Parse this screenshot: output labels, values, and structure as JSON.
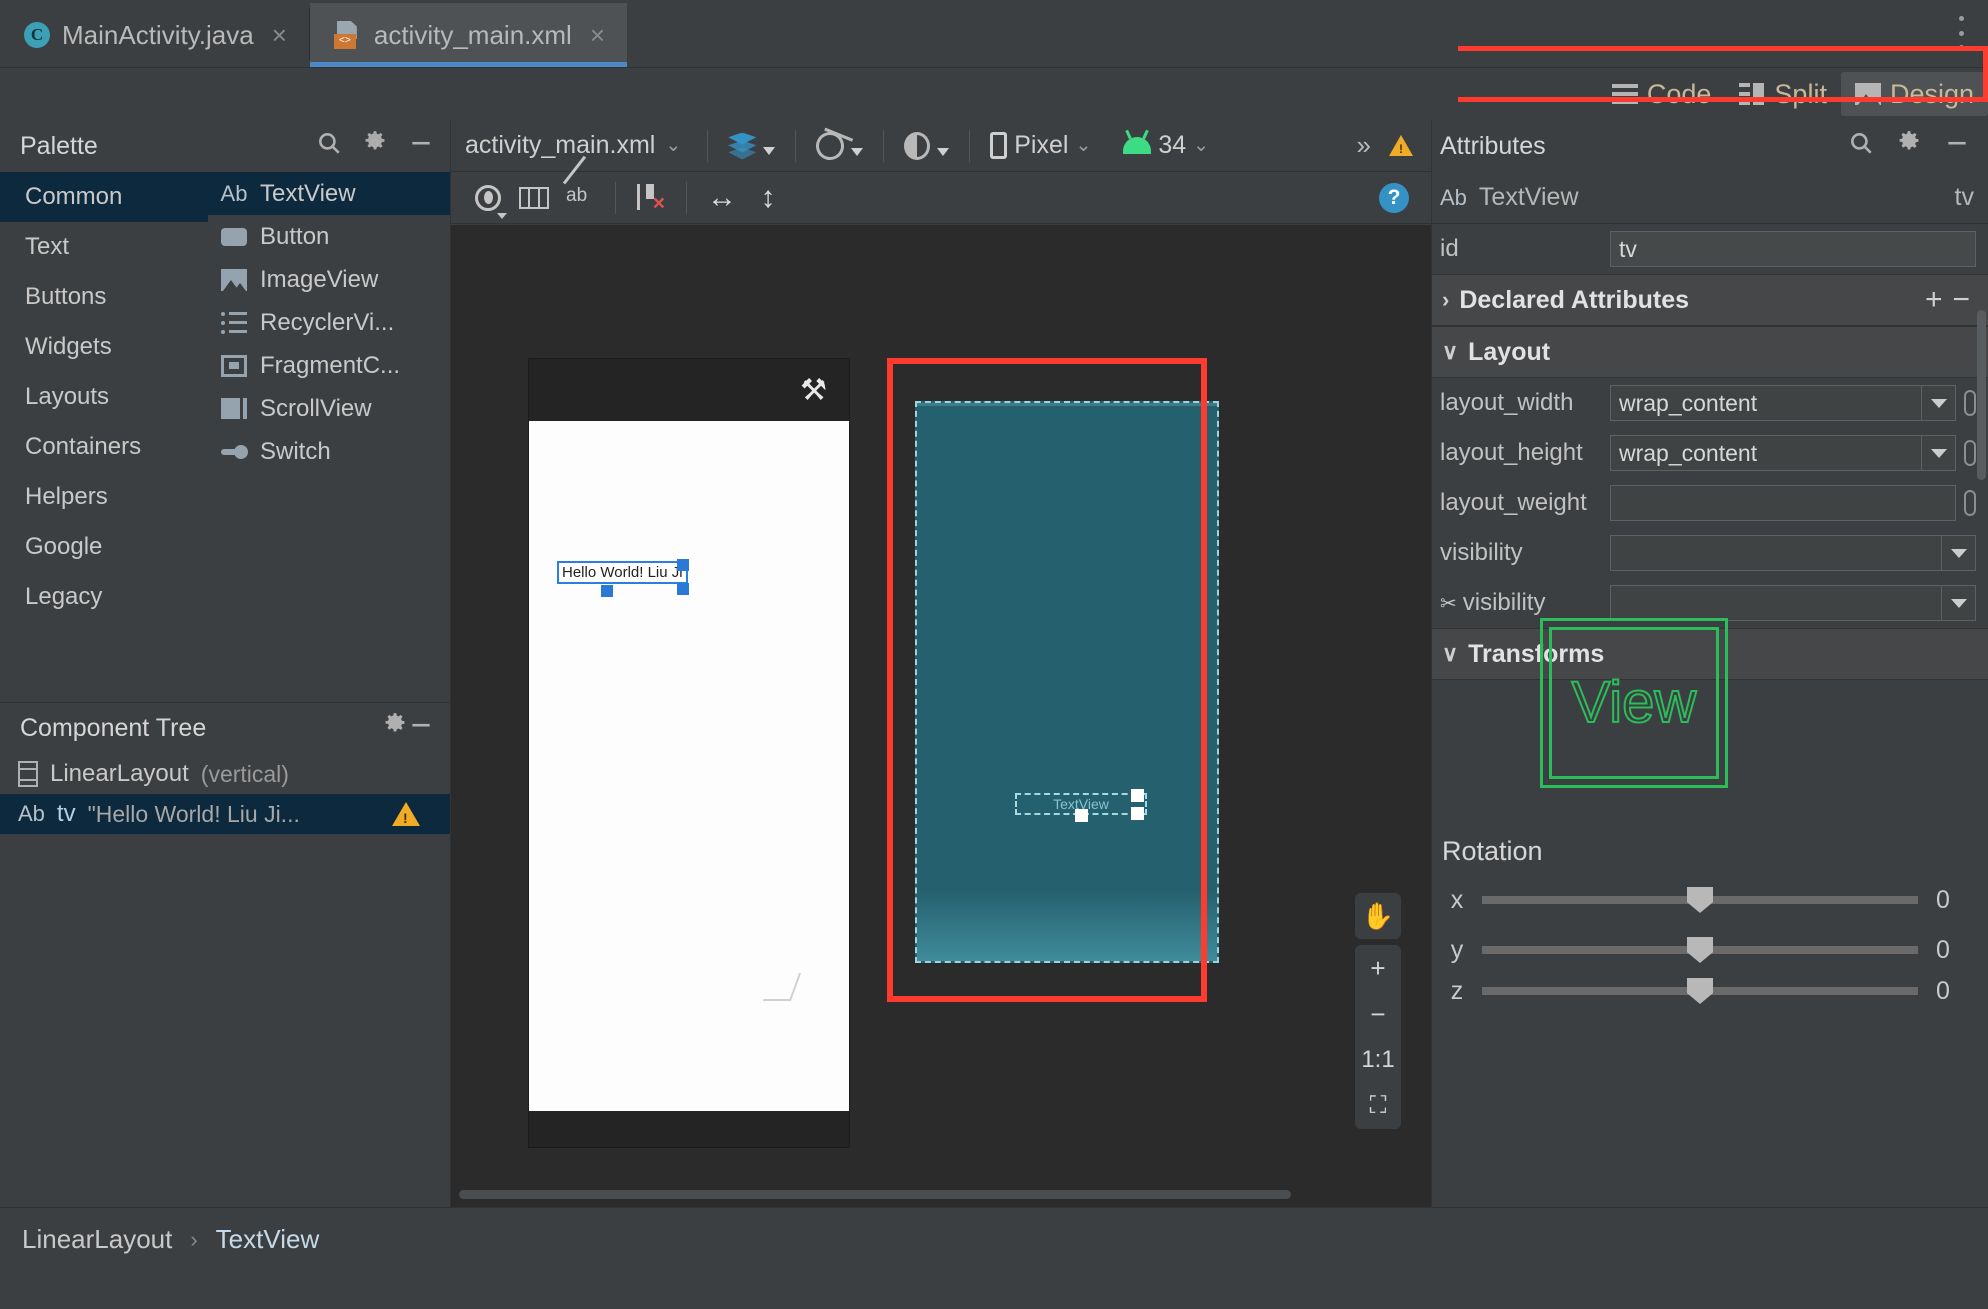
{
  "window": {
    "tabs": [
      {
        "label": "MainActivity.java",
        "icon": "java-class-icon",
        "active": false
      },
      {
        "label": "activity_main.xml",
        "icon": "xml-layout-icon",
        "active": true
      }
    ],
    "close_glyph": "×",
    "kebab_name": "more-options-icon"
  },
  "mode_switch": {
    "items": [
      {
        "label": "Code",
        "icon": "code-lines-icon",
        "selected": false
      },
      {
        "label": "Split",
        "icon": "split-view-icon",
        "selected": false
      },
      {
        "label": "Design",
        "icon": "design-view-icon",
        "selected": true
      }
    ],
    "highlight_color": "#ff3b30"
  },
  "palette": {
    "title": "Palette",
    "search_icon": "search-icon",
    "gear_icon": "gear-icon",
    "minimize_icon": "minimize-icon",
    "categories": [
      {
        "label": "Common",
        "selected": true
      },
      {
        "label": "Text",
        "selected": false
      },
      {
        "label": "Buttons",
        "selected": false
      },
      {
        "label": "Widgets",
        "selected": false
      },
      {
        "label": "Layouts",
        "selected": false
      },
      {
        "label": "Containers",
        "selected": false
      },
      {
        "label": "Helpers",
        "selected": false
      },
      {
        "label": "Google",
        "selected": false
      },
      {
        "label": "Legacy",
        "selected": false
      }
    ],
    "items": [
      {
        "label": "TextView",
        "icon": "textview-icon",
        "badge": "Ab",
        "selected": true
      },
      {
        "label": "Button",
        "icon": "button-icon",
        "selected": false
      },
      {
        "label": "ImageView",
        "icon": "imageview-icon",
        "selected": false
      },
      {
        "label": "RecyclerVi...",
        "icon": "recyclerview-icon",
        "selected": false
      },
      {
        "label": "FragmentC...",
        "icon": "fragment-icon",
        "selected": false
      },
      {
        "label": "ScrollView",
        "icon": "scrollview-icon",
        "selected": false
      },
      {
        "label": "Switch",
        "icon": "switch-icon",
        "selected": false
      }
    ]
  },
  "component_tree": {
    "title": "Component Tree",
    "gear_icon": "gear-icon",
    "minimize_icon": "minimize-icon",
    "nodes": [
      {
        "name": "LinearLayout",
        "qualifier": "(vertical)",
        "icon": "linearlayout-icon",
        "selected": false
      },
      {
        "badge": "Ab",
        "id": "tv",
        "value": "\"Hello World! Liu Ji...",
        "icon": "textview-icon",
        "warning_icon": "warning-triangle-icon",
        "selected": true
      }
    ]
  },
  "editor_toolbar": {
    "file_name": "activity_main.xml",
    "file_chevron": "⌄",
    "design_surface_icon": "layers-icon",
    "orientation_icon": "rotate-device-icon",
    "theme_icon": "theme-icon",
    "device_label": "Pixel",
    "device_icon": "phone-icon",
    "api_label": "34",
    "api_icon": "android-icon",
    "overflow_glyph": "»",
    "warning_icon": "warning-triangle-icon"
  },
  "editor_toolbar2": {
    "buttons": [
      {
        "name": "view-options-icon"
      },
      {
        "name": "layout-columns-icon"
      },
      {
        "name": "hide-blueprint-icon"
      },
      {
        "name": "clear-constraints-icon"
      },
      {
        "name": "expand-horizontal-icon"
      },
      {
        "name": "expand-vertical-icon"
      }
    ],
    "help_icon": "help-icon",
    "help_glyph": "?"
  },
  "canvas": {
    "device_preview": {
      "status_wrench_icon": "wrench-icon",
      "wrench_glyph": "⚒",
      "selected_text": "Hello World! Liu Ji",
      "selection_color": "#2b7fe0",
      "highlight_color": "#ff3b30"
    },
    "blueprint_preview": {
      "node_label": "TextView",
      "background_color": "#25606e"
    },
    "float_toolbar": {
      "pan_icon": "pan-hand-icon",
      "pan_glyph": "✋",
      "zoom_in_icon": "zoom-in-icon",
      "zoom_in_glyph": "+",
      "zoom_out_icon": "zoom-out-icon",
      "zoom_out_glyph": "−",
      "zoom_actual_icon": "zoom-actual-size-icon",
      "zoom_actual_glyph": "1:1",
      "zoom_fit_icon": "zoom-to-fit-icon",
      "zoom_fit_glyph": "⛶"
    }
  },
  "attributes": {
    "title": "Attributes",
    "search_icon": "search-icon",
    "gear_icon": "gear-icon",
    "minimize_icon": "minimize-icon",
    "component_badge": "Ab",
    "component_type": "TextView",
    "component_id": "tv",
    "id_row": {
      "label": "id",
      "value": "tv"
    },
    "sections": [
      {
        "label": "Declared Attributes",
        "expanded": false,
        "caret": "›",
        "plus": "+",
        "minus": "−"
      },
      {
        "label": "Layout",
        "expanded": true,
        "caret": "∨"
      },
      {
        "label": "Transforms",
        "expanded": true,
        "caret": "∨"
      }
    ],
    "layout_rows": [
      {
        "label": "layout_width",
        "value": "wrap_content",
        "type": "select"
      },
      {
        "label": "layout_height",
        "value": "wrap_content",
        "type": "select"
      },
      {
        "label": "layout_weight",
        "value": "",
        "type": "text"
      },
      {
        "label": "visibility",
        "value": "",
        "type": "select"
      },
      {
        "label": "visibility",
        "value": "",
        "type": "select",
        "wrench": true
      }
    ],
    "transforms": {
      "view_box_label": "View",
      "view_box_color": "#2bbd5a",
      "rotation_title": "Rotation",
      "rotation_rows": [
        {
          "axis": "x",
          "value": "0"
        },
        {
          "axis": "y",
          "value": "0"
        },
        {
          "axis": "z",
          "value": "0"
        }
      ]
    }
  },
  "breadcrumb": {
    "items": [
      {
        "label": "LinearLayout",
        "active": false
      },
      {
        "label": "TextView",
        "active": true
      }
    ],
    "separator": "›"
  }
}
